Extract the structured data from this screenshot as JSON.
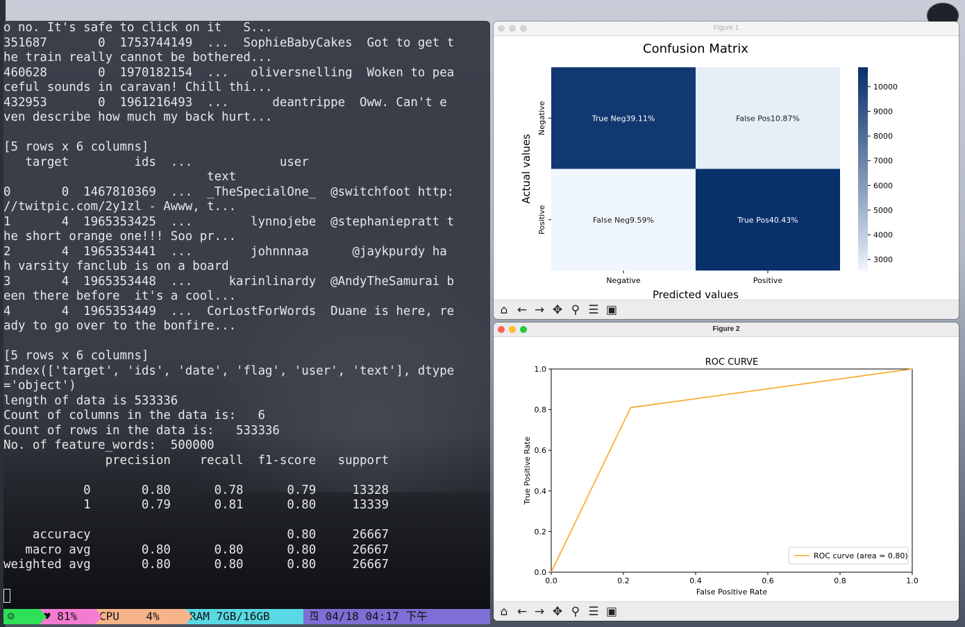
{
  "terminal": {
    "lines": [
      "o no. It's safe to click on it   S...",
      "351687       0  1753744149  ...  SophieBabyCakes  Got to get t",
      "he train really cannot be bothered...",
      "460628       0  1970182154  ...   oliversnelling  Woken to pea",
      "ceful sounds in caravan! Chill thi...",
      "432953       0  1961216493  ...      deantrippe  Oww. Can't e",
      "ven describe how much my back hurt...",
      "",
      "[5 rows x 6 columns]",
      "   target         ids  ...            user",
      "                            text",
      "0       0  1467810369  ...  _TheSpecialOne_  @switchfoot http:",
      "//twitpic.com/2y1zl - Awww, t...",
      "1       4  1965353425  ...        lynnojebe  @stephaniepratt t",
      "he short orange one!!! Soo pr...",
      "2       4  1965353441  ...        johnnnaa      @jaykpurdy ha",
      "h varsity fanclub is on a board",
      "3       4  1965353448  ...     karinlinardy  @AndyTheSamurai b",
      "een there before  it's a cool...",
      "4       4  1965353449  ...  CorLostForWords  Duane is here, re",
      "ady to go over to the bonfire...",
      "",
      "[5 rows x 6 columns]",
      "Index(['target', 'ids', 'date', 'flag', 'user', 'text'], dtype",
      "='object')",
      "length of data is 533336",
      "Count of columns in the data is:   6",
      "Count of rows in the data is:   533336",
      "No. of feature_words:  500000",
      "              precision    recall  f1-score   support",
      "",
      "           0       0.80      0.78      0.79     13328",
      "           1       0.79      0.81      0.80     13339",
      "",
      "    accuracy                           0.80     26667",
      "   macro avg       0.80      0.80      0.80     26667",
      "weighted avg       0.80      0.80      0.80     26667"
    ],
    "statusbar": {
      "smile": "☺",
      "battery": "♥ 81%",
      "cpu": "CPU    4%",
      "ram": "RAM 7GB/16GB",
      "datetime": "四 04/18 04:17 下午"
    }
  },
  "figure1": {
    "window_title": "Figure 1",
    "toolbar_icons": [
      "home-icon",
      "back-arrow-icon",
      "forward-arrow-icon",
      "pan-icon",
      "zoom-icon",
      "configure-subplots-icon",
      "save-icon"
    ],
    "chart_data": {
      "type": "heatmap",
      "title": "Confusion Matrix",
      "xlabel": "Predicted values",
      "ylabel": "Actual values",
      "x_categories": [
        "Negative",
        "Positive"
      ],
      "y_categories": [
        "Negative",
        "Positive"
      ],
      "cells": [
        {
          "row": 0,
          "col": 0,
          "label": "True Neg\n39.11%",
          "value": 10430
        },
        {
          "row": 0,
          "col": 1,
          "label": "False Pos\n10.87%",
          "value": 2898
        },
        {
          "row": 1,
          "col": 0,
          "label": "False Neg\n9.59%",
          "value": 2557
        },
        {
          "row": 1,
          "col": 1,
          "label": "True Pos\n40.43%",
          "value": 10782
        }
      ],
      "colorbar": {
        "min": 2557,
        "max": 10782,
        "ticks": [
          3000,
          4000,
          5000,
          6000,
          7000,
          8000,
          9000,
          10000
        ],
        "low_color": "#f0f6fd",
        "high_color": "#08306b"
      }
    }
  },
  "figure2": {
    "window_title": "Figure 2",
    "toolbar_icons": [
      "home-icon",
      "back-arrow-icon",
      "forward-arrow-icon",
      "pan-icon",
      "zoom-icon",
      "configure-subplots-icon",
      "save-icon"
    ],
    "chart_data": {
      "type": "line",
      "title": "ROC CURVE",
      "xlabel": "False Positive Rate",
      "ylabel": "True Positive Rate",
      "xlim": [
        0.0,
        1.0
      ],
      "ylim": [
        0.0,
        1.0
      ],
      "xticks": [
        "0.0",
        "0.2",
        "0.4",
        "0.6",
        "0.8",
        "1.0"
      ],
      "yticks": [
        "0.0",
        "0.2",
        "0.4",
        "0.6",
        "0.8",
        "1.0"
      ],
      "series": [
        {
          "name": "ROC curve (area = 0.80)",
          "color": "#f5a623",
          "x": [
            0.0,
            0.22,
            1.0
          ],
          "y": [
            0.0,
            0.81,
            1.0
          ]
        }
      ],
      "legend": "lower-right"
    }
  }
}
